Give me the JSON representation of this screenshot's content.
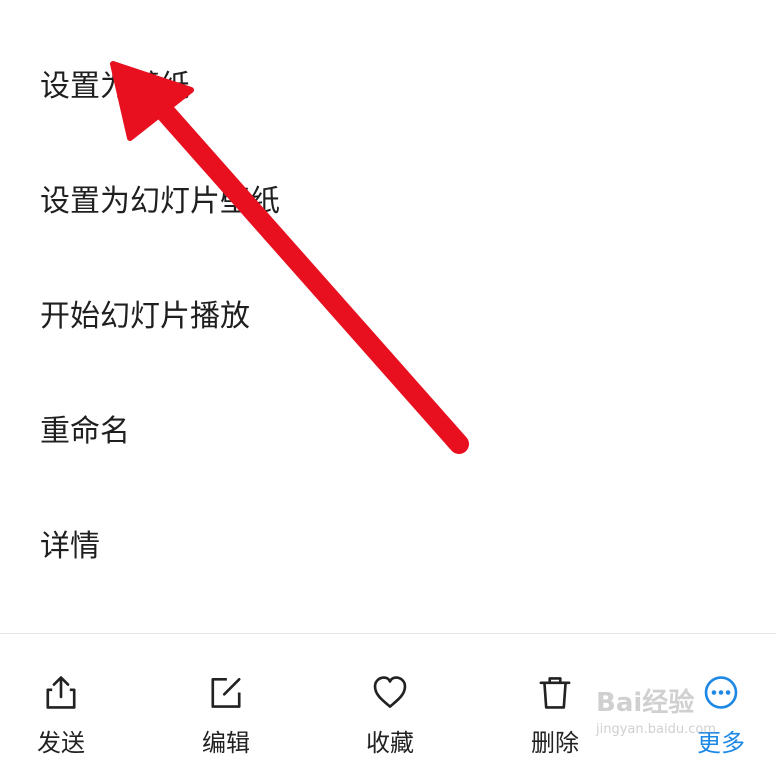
{
  "menu": {
    "items": [
      {
        "label": "设置为壁纸"
      },
      {
        "label": "设置为幻灯片壁纸"
      },
      {
        "label": "开始幻灯片播放"
      },
      {
        "label": "重命名"
      },
      {
        "label": "详情"
      }
    ]
  },
  "bottom_bar": {
    "actions": [
      {
        "label": "发送",
        "icon": "share-icon"
      },
      {
        "label": "编辑",
        "icon": "edit-icon"
      },
      {
        "label": "收藏",
        "icon": "heart-icon"
      },
      {
        "label": "删除",
        "icon": "trash-icon"
      },
      {
        "label": "更多",
        "icon": "more-icon"
      }
    ]
  },
  "watermark": {
    "main": "Bai经验",
    "sub": "jingyan.baidu.com"
  },
  "colors": {
    "accent": "#1e88e5",
    "arrow": "#e8101f",
    "text": "#1f1f1f"
  }
}
